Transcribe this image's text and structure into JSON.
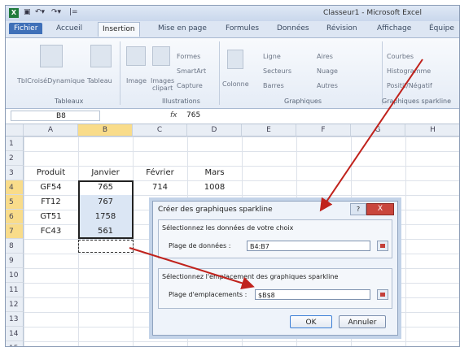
{
  "window": {
    "title": "Classeur1 - Microsoft Excel",
    "app_icon": "X"
  },
  "tabs": [
    {
      "label": "Fichier"
    },
    {
      "label": "Accueil"
    },
    {
      "label": "Insertion"
    },
    {
      "label": "Mise en page"
    },
    {
      "label": "Formules"
    },
    {
      "label": "Données"
    },
    {
      "label": "Révision"
    },
    {
      "label": "Affichage"
    },
    {
      "label": "Équipe"
    }
  ],
  "ribbon": {
    "buttons": {
      "tcd": "TblCroiséDynamique",
      "tableau": "Tableau",
      "image": "Image",
      "images_clipart": "Images",
      "images_clipart2": "clipart",
      "formes": "Formes",
      "smartart": "SmartArt",
      "capture": "Capture",
      "colonne": "Colonne",
      "ligne": "Ligne",
      "secteurs": "Secteurs",
      "barres": "Barres",
      "aires": "Aires",
      "nuage": "Nuage",
      "autres": "Autres",
      "courbes": "Courbes",
      "histogramme": "Histogramme",
      "positif_negatif": "Positif/Négatif"
    },
    "groups": {
      "tableaux": "Tableaux",
      "illustrations": "Illustrations",
      "graphiques": "Graphiques",
      "sparkline": "Graphiques sparkline"
    }
  },
  "formula_bar": {
    "name_box": "B8",
    "fx": "fx",
    "value": "765"
  },
  "columns": [
    "A",
    "B",
    "C",
    "D",
    "E",
    "F",
    "G",
    "H"
  ],
  "rows": [
    "1",
    "2",
    "3",
    "4",
    "5",
    "6",
    "7",
    "8",
    "9",
    "10",
    "11",
    "12",
    "13",
    "14",
    "15"
  ],
  "cells": {
    "A3": "Produit",
    "B3": "Janvier",
    "C3": "Février",
    "D3": "Mars",
    "A4": "GF54",
    "B4": "765",
    "C4": "714",
    "D4": "1008",
    "A5": "FT12",
    "B5": "767",
    "A6": "GT51",
    "B6": "1758",
    "A7": "FC43",
    "B7": "561"
  },
  "dialog": {
    "title": "Créer des graphiques sparkline",
    "help": "?",
    "close": "X",
    "section1": "Sélectionnez les données de votre choix",
    "data_range_label": "Plage de données :",
    "data_range_value": "B4:B7",
    "section2": "Sélectionnez l'emplacement des graphiques sparkline",
    "location_label": "Plage d'emplacements :",
    "location_value": "$B$8",
    "ok": "OK",
    "cancel": "Annuler"
  }
}
